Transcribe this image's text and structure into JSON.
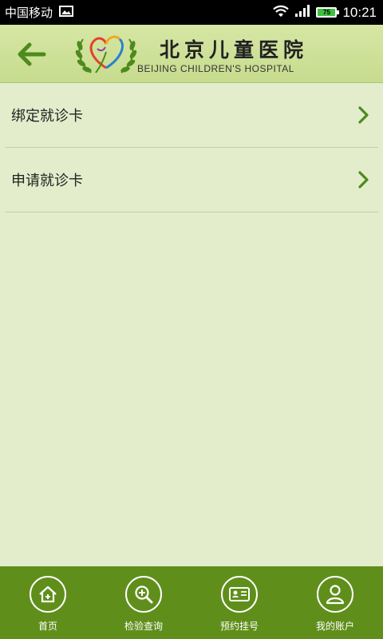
{
  "status_bar": {
    "carrier": "中国移动",
    "battery": "75",
    "time": "10:21"
  },
  "header": {
    "hospital_name_cn": "北京儿童医院",
    "hospital_name_en": "BEIJING CHILDREN'S HOSPITAL"
  },
  "menu": {
    "items": [
      {
        "label": "绑定就诊卡"
      },
      {
        "label": "申请就诊卡"
      }
    ]
  },
  "bottom_nav": {
    "items": [
      {
        "label": "首页",
        "icon": "home-icon"
      },
      {
        "label": "检验查询",
        "icon": "search-zoom-icon"
      },
      {
        "label": "预约挂号",
        "icon": "id-card-icon"
      },
      {
        "label": "我的账户",
        "icon": "user-icon"
      }
    ]
  },
  "colors": {
    "header_bg": "#c6dc8e",
    "page_bg": "#e3edcc",
    "nav_bg": "#5f8f1a",
    "accent": "#4e8a1c"
  }
}
